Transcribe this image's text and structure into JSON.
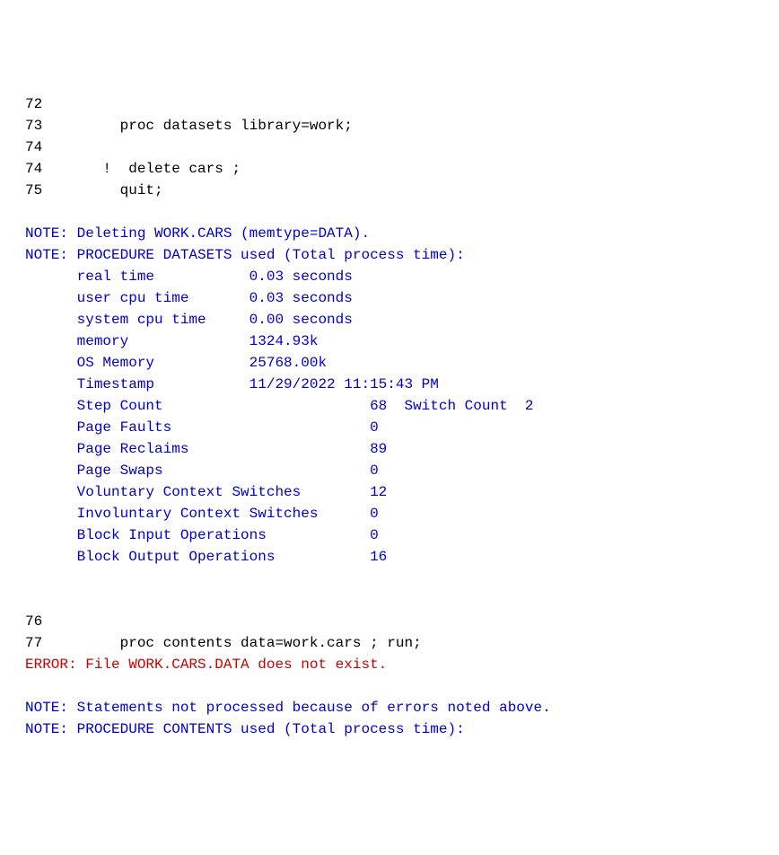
{
  "lines": [
    {
      "class": "code",
      "text": "72"
    },
    {
      "class": "code",
      "text": "73         proc datasets library=work;"
    },
    {
      "class": "code",
      "text": "74"
    },
    {
      "class": "code",
      "text": "74       !  delete cars ;"
    },
    {
      "class": "code",
      "text": "75         quit;"
    },
    {
      "class": "code",
      "text": ""
    },
    {
      "class": "note",
      "text": "NOTE: Deleting WORK.CARS (memtype=DATA)."
    },
    {
      "class": "note",
      "text": "NOTE: PROCEDURE DATASETS used (Total process time):"
    },
    {
      "class": "note",
      "text": "      real time           0.03 seconds"
    },
    {
      "class": "note",
      "text": "      user cpu time       0.03 seconds"
    },
    {
      "class": "note",
      "text": "      system cpu time     0.00 seconds"
    },
    {
      "class": "note",
      "text": "      memory              1324.93k"
    },
    {
      "class": "note",
      "text": "      OS Memory           25768.00k"
    },
    {
      "class": "note",
      "text": "      Timestamp           11/29/2022 11:15:43 PM"
    },
    {
      "class": "note",
      "text": "      Step Count                        68  Switch Count  2"
    },
    {
      "class": "note",
      "text": "      Page Faults                       0"
    },
    {
      "class": "note",
      "text": "      Page Reclaims                     89"
    },
    {
      "class": "note",
      "text": "      Page Swaps                        0"
    },
    {
      "class": "note",
      "text": "      Voluntary Context Switches        12"
    },
    {
      "class": "note",
      "text": "      Involuntary Context Switches      0"
    },
    {
      "class": "note",
      "text": "      Block Input Operations            0"
    },
    {
      "class": "note",
      "text": "      Block Output Operations           16"
    },
    {
      "class": "code",
      "text": "      "
    },
    {
      "class": "code",
      "text": ""
    },
    {
      "class": "code",
      "text": "76"
    },
    {
      "class": "code",
      "text": "77         proc contents data=work.cars ; run;"
    },
    {
      "class": "error",
      "text": "ERROR: File WORK.CARS.DATA does not exist."
    },
    {
      "class": "code",
      "text": ""
    },
    {
      "class": "note",
      "text": "NOTE: Statements not processed because of errors noted above."
    },
    {
      "class": "note",
      "text": "NOTE: PROCEDURE CONTENTS used (Total process time):"
    }
  ]
}
